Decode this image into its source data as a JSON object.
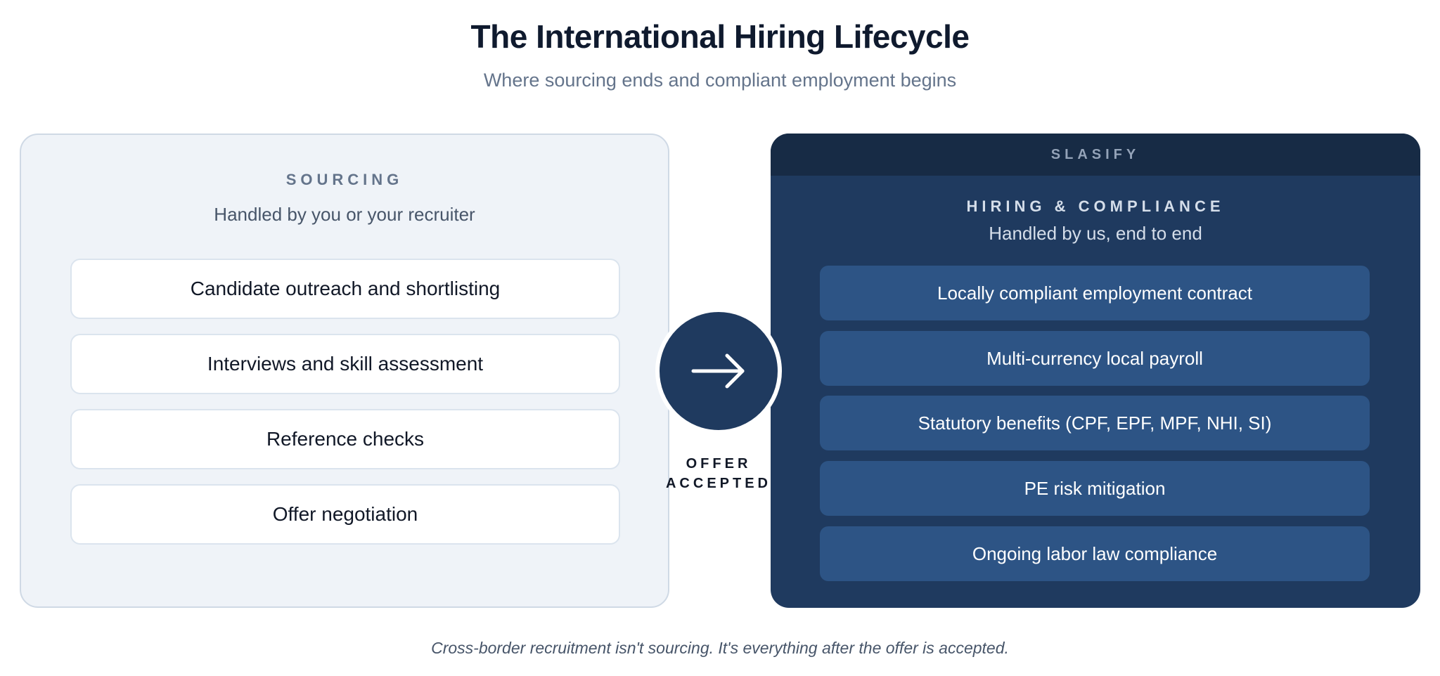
{
  "title": "The International Hiring Lifecycle",
  "subtitle": "Where sourcing ends and compliant employment begins",
  "sourcing": {
    "heading": "SOURCING",
    "subheading": "Handled by you or your recruiter",
    "items": [
      "Candidate outreach and shortlisting",
      "Interviews and skill assessment",
      "Reference checks",
      "Offer negotiation"
    ]
  },
  "connector": {
    "icon": "arrow-right-icon",
    "label_line1": "OFFER",
    "label_line2": "ACCEPTED"
  },
  "slasify": {
    "brand": "SLASIFY",
    "heading": "HIRING & COMPLIANCE",
    "subheading": "Handled by us, end to end",
    "items": [
      "Locally compliant employment contract",
      "Multi-currency local payroll",
      "Statutory benefits (CPF, EPF, MPF, NHI, SI)",
      "PE risk mitigation",
      "Ongoing labor law compliance"
    ]
  },
  "footer_note": "Cross-border recruitment isn't sourcing. It's everything after the offer is accepted.",
  "colors": {
    "navy": "#1f3a5f",
    "navy_dark": "#172b45",
    "item_blue": "#2d5485",
    "light_panel": "#eff3f8",
    "title_text": "#0f1a2e"
  }
}
